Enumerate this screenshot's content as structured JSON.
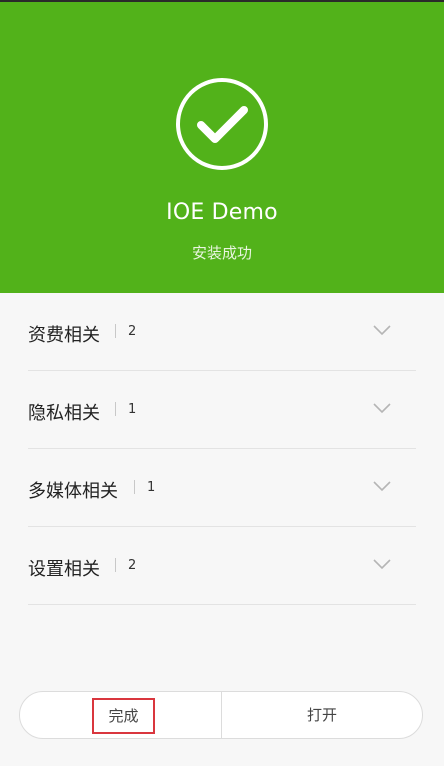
{
  "app": {
    "name": "IOE Demo",
    "status": "安装成功",
    "accent": "#52b21a"
  },
  "categories": [
    {
      "label": "资费相关",
      "count": "2"
    },
    {
      "label": "隐私相关",
      "count": "1"
    },
    {
      "label": "多媒体相关",
      "count": "1"
    },
    {
      "label": "设置相关",
      "count": "2"
    }
  ],
  "buttons": {
    "done": "完成",
    "open": "打开"
  },
  "icons": {
    "success": "check-circle-icon",
    "expand": "chevron-down-icon"
  }
}
